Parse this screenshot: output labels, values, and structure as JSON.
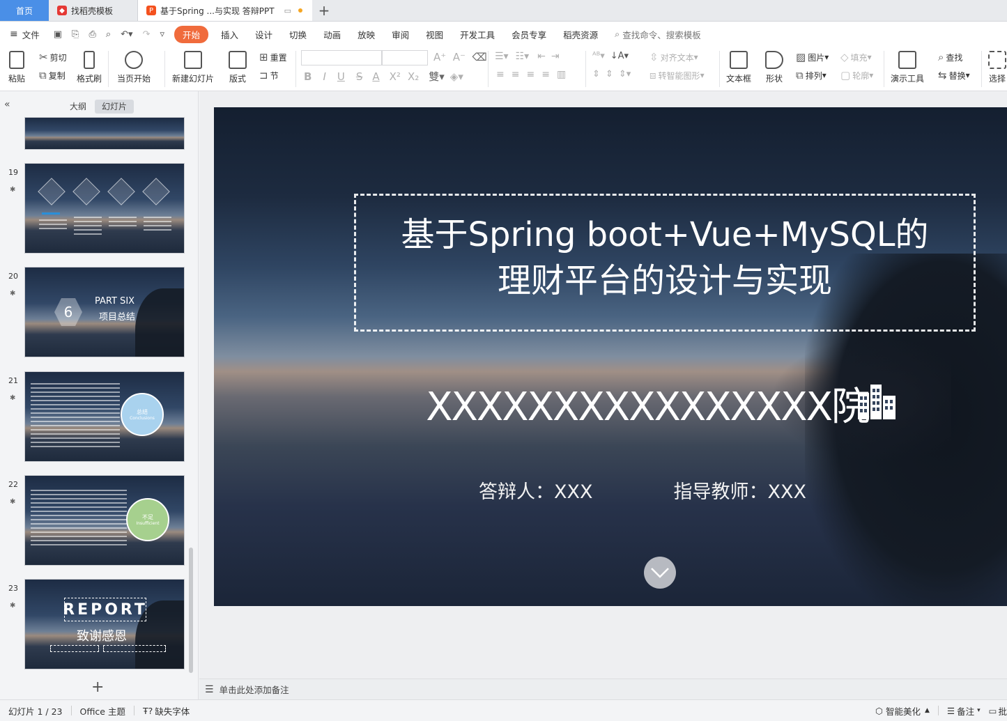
{
  "tabs": [
    {
      "label": "首页"
    },
    {
      "label": "找稻壳模板"
    },
    {
      "label": "基于Spring ...与实现 答辩PPT"
    }
  ],
  "menu": {
    "file": "文件",
    "items": [
      "开始",
      "插入",
      "设计",
      "切换",
      "动画",
      "放映",
      "审阅",
      "视图",
      "开发工具",
      "会员专享",
      "稻壳资源"
    ],
    "search": "查找命令、搜索模板"
  },
  "ribbon": {
    "paste": "粘贴",
    "cut": "剪切",
    "copy": "复制",
    "format_painter": "格式刷",
    "from_current": "当页开始",
    "new_slide": "新建幻灯片",
    "layout": "版式",
    "reset": "重置",
    "section": "节",
    "align_text": "对齐文本",
    "smart_shape": "转智能图形",
    "textbox": "文本框",
    "shape": "形状",
    "picture": "图片",
    "arrange": "排列",
    "fill": "填充",
    "outline": "轮廓",
    "presentation_tools": "演示工具",
    "find": "查找",
    "replace": "替换",
    "select": "选择",
    "bold": "B",
    "italic": "I",
    "underline": "U",
    "strike": "S",
    "font_color": "A",
    "sup": "X²",
    "sub": "X₂"
  },
  "left_pane": {
    "outline_tab": "大纲",
    "slides_tab": "幻灯片",
    "slides": [
      {
        "num": "19",
        "kind": "four-icons"
      },
      {
        "num": "20",
        "kind": "section",
        "part": "PART SIX",
        "subtitle": "项目总结",
        "number": "6"
      },
      {
        "num": "21",
        "kind": "text-circle",
        "circle_cn": "总结",
        "circle_en": "Conclusions"
      },
      {
        "num": "22",
        "kind": "text-circle",
        "circle_cn": "不足",
        "circle_en": "Insufficient"
      },
      {
        "num": "23",
        "kind": "end",
        "report": "REPORT",
        "thanks": "致谢感恩"
      }
    ]
  },
  "slide": {
    "title_line1": "基于Spring boot+Vue+MySQL的",
    "title_line2": "理财平台的设计与实现",
    "college": "XXXXXXXXXXXXXXXX院",
    "presenter": "答辩人：XXX",
    "advisor": "指导教师：XXX",
    "building_icon": "building-icon",
    "down_icon": "chevron-down-icon"
  },
  "notes": {
    "placeholder": "单击此处添加备注"
  },
  "status": {
    "slide_counter": "幻灯片 1 / 23",
    "theme": "Office 主题",
    "missing_font": "缺失字体",
    "beautify": "智能美化",
    "notes": "备注",
    "comments": "批"
  },
  "colors": {
    "accent": "#f06b3c",
    "home_tab": "#4a8fe7"
  }
}
